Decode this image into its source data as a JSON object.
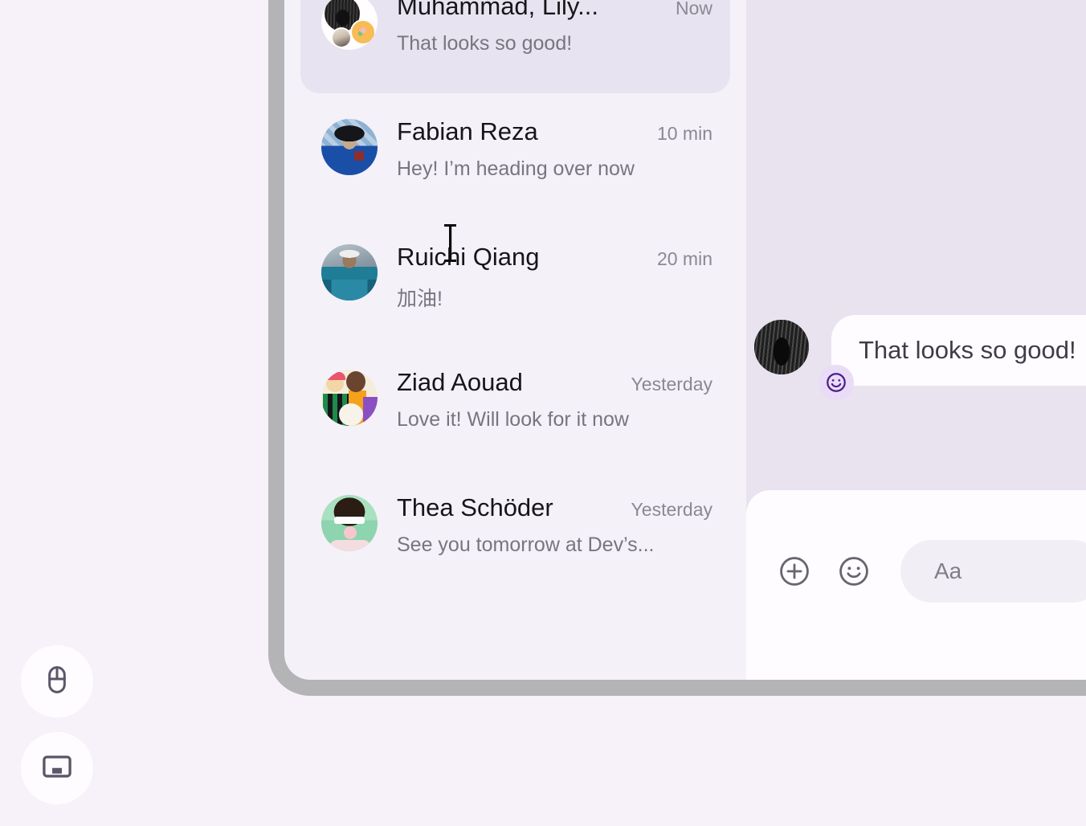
{
  "theme": {
    "page_background": "#f7f2fa",
    "list_background": "#f5f1f8",
    "chat_background": "#e8e3ef",
    "selected_item_background": "#e8e3f0",
    "bubble_background": "#fffcff",
    "reaction_background": "#eadcf7",
    "reaction_accent": "#4a1d8c",
    "window_frame": "#b4b4b6",
    "name_text": "#16161a",
    "preview_text": "#78757f",
    "time_text": "#8b8893"
  },
  "conversation_list": {
    "items": [
      {
        "name": "Muhammad, Lily...",
        "time": "Now",
        "preview": "That looks so good!",
        "avatar": "group-avatar",
        "selected": true
      },
      {
        "name": "Fabian Reza",
        "time": "10 min",
        "preview": "Hey! I’m heading over now",
        "avatar": "avatar-fabian-reza",
        "selected": false
      },
      {
        "name": "Ruichi Qiang",
        "time": "20 min",
        "preview": "加油!",
        "avatar": "avatar-ruichi-qiang",
        "selected": false
      },
      {
        "name": "Ziad Aouad",
        "time": "Yesterday",
        "preview": "Love it! Will look for it now",
        "avatar": "avatar-ziad-aouad",
        "selected": false
      },
      {
        "name": "Thea Schöder",
        "time": "Yesterday",
        "preview": "See you tomorrow at Dev’s...",
        "avatar": "avatar-thea-schoder",
        "selected": false
      }
    ]
  },
  "chat": {
    "message": {
      "text": "That looks so good!",
      "sender_avatar": "avatar-dark-figure",
      "reaction_icon": "smiley-face-icon"
    }
  },
  "composer": {
    "add_attachment_icon": "plus-circle-icon",
    "emoji_icon": "smiley-face-icon",
    "input_placeholder": "Aa",
    "input_value": ""
  },
  "floating_controls": [
    {
      "icon": "mouse-icon",
      "name": "mouse-mode-button"
    },
    {
      "icon": "trackpad-icon",
      "name": "trackpad-mode-button"
    }
  ],
  "cursor": {
    "type": "i-beam-text-cursor"
  }
}
